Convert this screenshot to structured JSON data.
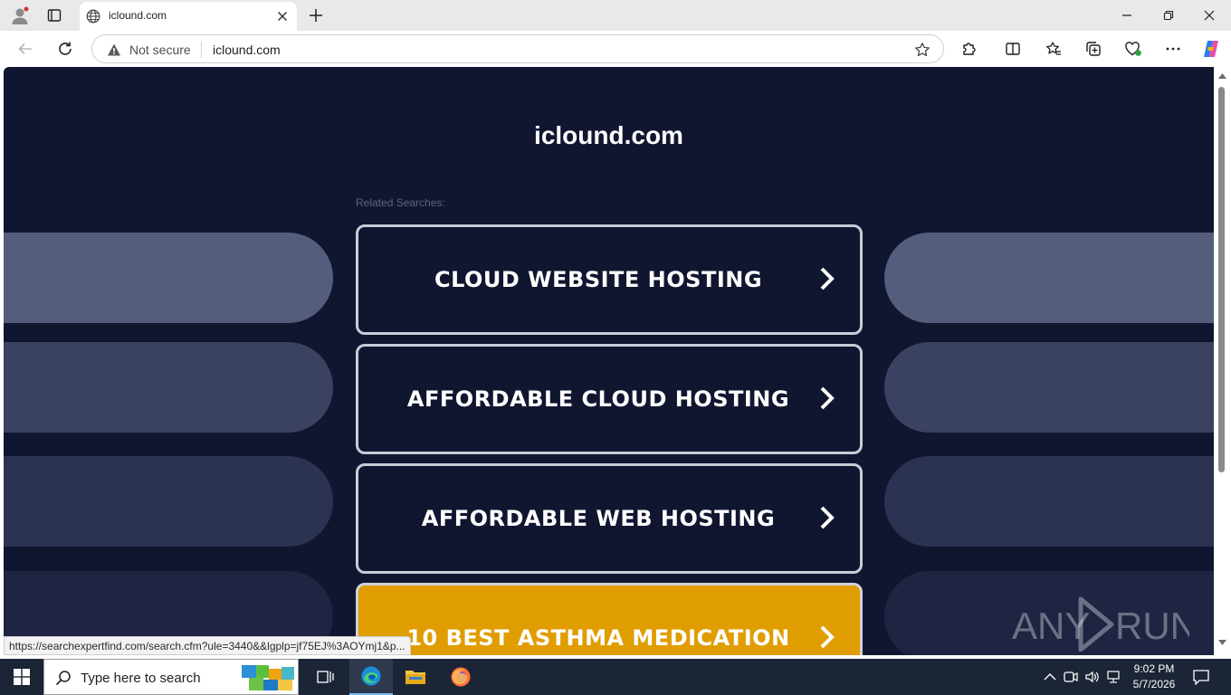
{
  "browser": {
    "tab": {
      "title": "iclound.com"
    },
    "omnibox": {
      "security": "Not secure",
      "url": "iclound.com"
    },
    "status_url": "https://searchexpertfind.com/search.cfm?ule=3440&&lgplp=jf75EJ%3AOYmj1&p..."
  },
  "page": {
    "site_title": "iclound.com",
    "related_label": "Related Searches:",
    "searches": [
      {
        "label": "CLOUD WEBSITE HOSTING"
      },
      {
        "label": "AFFORDABLE CLOUD HOSTING"
      },
      {
        "label": "AFFORDABLE WEB HOSTING"
      },
      {
        "label": "10 BEST ASTHMA MEDICATION"
      }
    ],
    "watermark": "ANY RUN"
  },
  "taskbar": {
    "search_placeholder": "Type here to search",
    "time": "9:02 PM",
    "date": "5/7/2026"
  },
  "colors": {
    "page_bg": "#111630",
    "highlight": "#e09d00",
    "pill_1": "#555d7d",
    "pill_2": "#3a4161",
    "pill_3": "#2b3252",
    "pill_4": "#1e2442"
  }
}
